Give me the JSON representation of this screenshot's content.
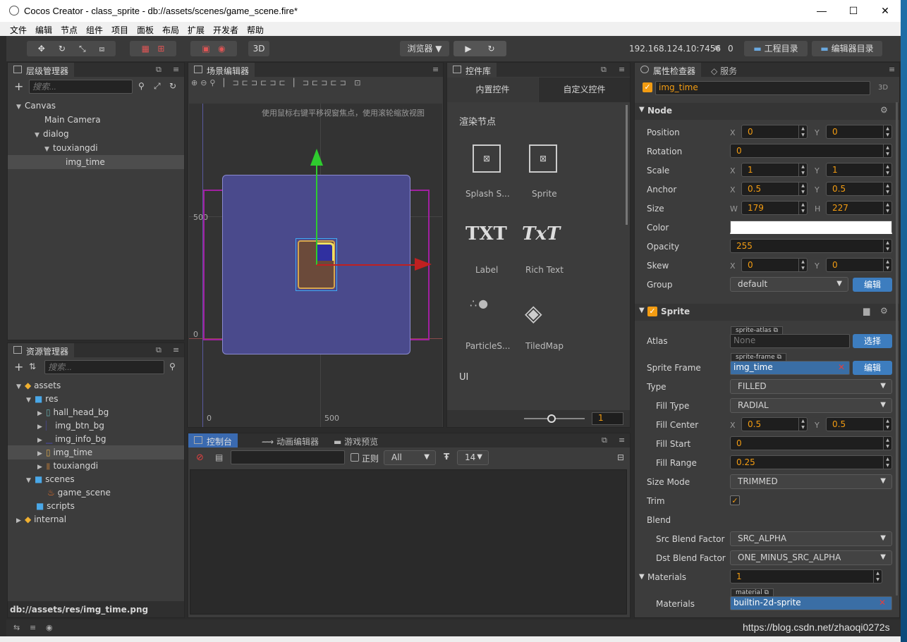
{
  "window": {
    "title": "Cocos Creator - class_sprite - db://assets/scenes/game_scene.fire*",
    "min": "—",
    "max": "☐",
    "close": "✕"
  },
  "menu": [
    "文件",
    "编辑",
    "节点",
    "组件",
    "项目",
    "面板",
    "布局",
    "扩展",
    "开发者",
    "帮助"
  ],
  "toolbar": {
    "mode3d": "3D",
    "browser": "浏览器 ▼",
    "ip": "192.168.124.10:7456",
    "count": "0",
    "project_dir": "工程目录",
    "editor_dir": "编辑器目录"
  },
  "hierarchy": {
    "title": "层级管理器",
    "search_placeholder": "搜索...",
    "nodes": [
      "Canvas",
      "Main Camera",
      "dialog",
      "touxiangdi",
      "img_time"
    ]
  },
  "assets": {
    "title": "资源管理器",
    "search_placeholder": "搜索...",
    "items": [
      "assets",
      "res",
      "hall_head_bg",
      "img_btn_bg",
      "img_info_bg",
      "img_time",
      "touxiangdi",
      "scenes",
      "game_scene",
      "scripts",
      "internal"
    ],
    "status": "db://assets/res/img_time.png"
  },
  "scene": {
    "title": "场景编辑器",
    "hint": "使用鼠标右键平移视窗焦点，使用滚轮缩放视图",
    "ruler_y_500": "500",
    "ruler_y_0": "0",
    "ruler_x_0": "0",
    "ruler_x_500": "500"
  },
  "library": {
    "title": "控件库",
    "tab_builtin": "内置控件",
    "tab_custom": "自定义控件",
    "section_render": "渲染节点",
    "items": [
      "Splash S...",
      "Sprite",
      "Label",
      "Rich Text",
      "ParticleS...",
      "TiledMap"
    ],
    "section_ui": "UI",
    "zoom": "1"
  },
  "console": {
    "tab_console": "控制台",
    "tab_anim": "动画编辑器",
    "tab_preview": "游戏预览",
    "regex": "正则",
    "level": "All",
    "font_size": "14"
  },
  "inspector": {
    "title": "属性检查器",
    "tab_service": "服务",
    "node_name": "img_time",
    "d3": "3D",
    "node_section": "Node",
    "position_label": "Position",
    "pos_x": "0",
    "pos_y": "0",
    "rotation_label": "Rotation",
    "rotation": "0",
    "scale_label": "Scale",
    "scale_x": "1",
    "scale_y": "1",
    "anchor_label": "Anchor",
    "anchor_x": "0.5",
    "anchor_y": "0.5",
    "size_label": "Size",
    "size_w": "179",
    "size_h": "227",
    "color_label": "Color",
    "opacity_label": "Opacity",
    "opacity": "255",
    "skew_label": "Skew",
    "skew_x": "0",
    "skew_y": "0",
    "group_label": "Group",
    "group": "default",
    "edit": "编辑",
    "sprite_section": "Sprite",
    "atlas_label": "Atlas",
    "atlas_tag": "sprite-atlas",
    "atlas_value": "None",
    "select": "选择",
    "frame_label": "Sprite Frame",
    "frame_tag": "sprite-frame",
    "frame_value": "img_time",
    "type_label": "Type",
    "type": "FILLED",
    "filltype_label": "Fill Type",
    "filltype": "RADIAL",
    "fillcenter_label": "Fill Center",
    "fillcenter_x": "0.5",
    "fillcenter_y": "0.5",
    "fillstart_label": "Fill Start",
    "fillstart": "0",
    "fillrange_label": "Fill Range",
    "fillrange": "0.25",
    "sizemode_label": "Size Mode",
    "sizemode": "TRIMMED",
    "trim_label": "Trim",
    "blend_label": "Blend",
    "src_label": "Src Blend Factor",
    "src": "SRC_ALPHA",
    "dst_label": "Dst Blend Factor",
    "dst": "ONE_MINUS_SRC_ALPHA",
    "materials_section": "Materials",
    "materials_count": "1",
    "materials_label": "Materials",
    "material_tag": "material",
    "material_value": "builtin-2d-sprite"
  },
  "watermark": "https://blog.csdn.net/zhaoqi0272s"
}
